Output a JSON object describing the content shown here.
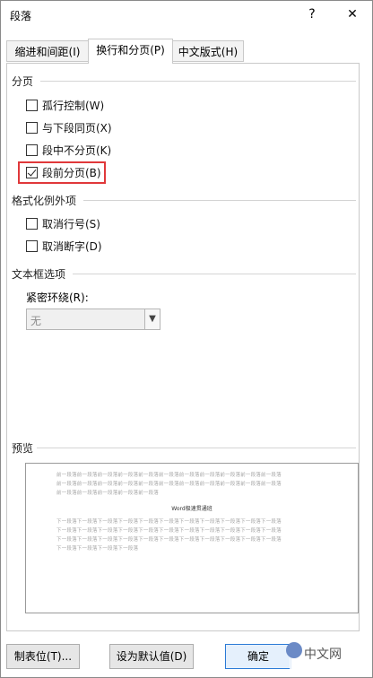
{
  "window": {
    "title": "段落"
  },
  "titlebar": {
    "help": "?",
    "close": "✕"
  },
  "tabs": [
    {
      "label": "缩进和间距(I)"
    },
    {
      "label": "换行和分页(P)"
    },
    {
      "label": "中文版式(H)"
    }
  ],
  "sections": {
    "pagination": "分页",
    "format_exceptions": "格式化例外项",
    "textbox_options": "文本框选项",
    "preview": "预览"
  },
  "pagination": [
    {
      "label": "孤行控制(W)",
      "checked": false
    },
    {
      "label": "与下段同页(X)",
      "checked": false
    },
    {
      "label": "段中不分页(K)",
      "checked": false
    },
    {
      "label": "段前分页(B)",
      "checked": true
    }
  ],
  "exceptions": [
    {
      "label": "取消行号(S)",
      "checked": false
    },
    {
      "label": "取消断字(D)",
      "checked": false
    }
  ],
  "textbox": {
    "tight_wrap_label": "紧密环绕(R):",
    "tight_wrap_value": "无"
  },
  "preview": {
    "prev_lines": [
      "前一段落前一段落前一段落前一段落前一段落前一段落前一段落前一段落前一段落前一段落前一段落",
      "前一段落前一段落前一段落前一段落前一段落前一段落前一段落前一段落前一段落前一段落前一段落",
      "前一段落前一段落前一段落前一段落前一段落"
    ],
    "current": "Word极速贯通班",
    "next_lines": [
      "下一段落下一段落下一段落下一段落下一段落下一段落下一段落下一段落下一段落下一段落下一段落",
      "下一段落下一段落下一段落下一段落下一段落下一段落下一段落下一段落下一段落下一段落下一段落",
      "下一段落下一段落下一段落下一段落下一段落下一段落下一段落下一段落下一段落下一段落下一段落",
      "下一段落下一段落下一段落下一段落"
    ]
  },
  "buttons": {
    "tabs": "制表位(T)...",
    "default": "设为默认值(D)",
    "ok": "确定"
  },
  "watermark": {
    "text": "中文网"
  },
  "colors": {
    "highlight": "#e0383a",
    "primary_border": "#2a7ad6"
  }
}
